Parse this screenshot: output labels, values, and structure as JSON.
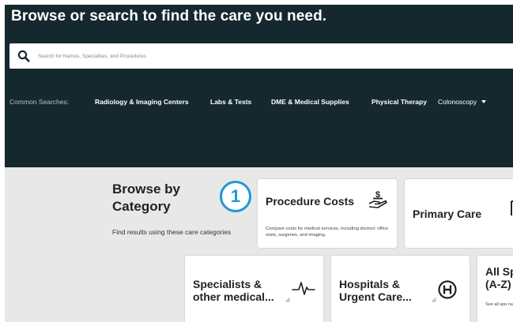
{
  "hero": {
    "title": "Browse or search to find the care you need.",
    "bg_color": "#15282e"
  },
  "search": {
    "placeholder": "Search for Names, Specialties, and Procedures",
    "value": "",
    "icon": "search-icon"
  },
  "common_searches": {
    "label": "Common Searches:",
    "links": [
      "Radiology & Imaging Centers",
      "Labs & Tests",
      "DME & Medical Supplies",
      "Physical Therapy"
    ],
    "more": "Colonoscopy"
  },
  "browse": {
    "title": "Browse by Category",
    "subtitle": "Find results using these care categories",
    "step_number": "1",
    "accent_color": "#1c9ad6"
  },
  "cards": {
    "procedure_costs": {
      "title": "Procedure Costs",
      "description": "Compare costs for medical services, including doctors' office visits, surgeries, and imaging.",
      "icon": "hand-dollar-icon"
    },
    "primary_care": {
      "title": "Primary Care",
      "icon": "primary-care-icon"
    },
    "specialists": {
      "title": "Specialists & other medical...",
      "icon": "heartbeat-icon"
    },
    "hospitals": {
      "title": "Hospitals & Urgent Care...",
      "icon": "hospital-h-icon"
    },
    "all_specialties": {
      "title": "All Sp (A-Z)",
      "description": "See all spe name"
    }
  }
}
